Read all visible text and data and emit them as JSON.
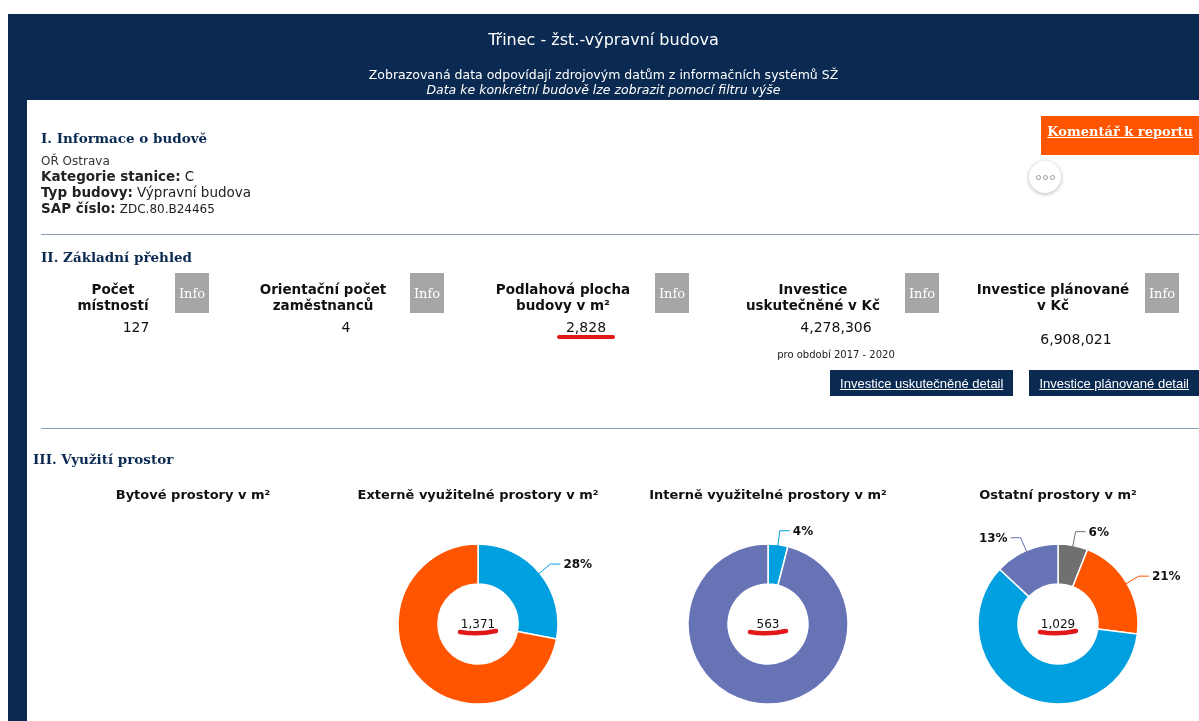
{
  "header": {
    "title": "Třinec - žst.-výpravní budova",
    "subtitle": "Zobrazovaná data odpovídají zdrojovým datům z informačních systémů SŽ",
    "note": "Data ke konkrétní budově lze zobrazit pomocí filtru výše"
  },
  "comment_button": "Komentář k reportu",
  "section_1": {
    "heading": "I. Informace o budově",
    "region": "OŘ Ostrava",
    "fields": [
      {
        "label": "Kategorie stanice:",
        "value": "C"
      },
      {
        "label": "Typ budovy:",
        "value": "Výpravní budova"
      },
      {
        "label": "SAP číslo:",
        "value": "ZDC.80.B24465"
      }
    ]
  },
  "section_2": {
    "heading": "II. Základní přehled",
    "metrics": [
      {
        "label": "Počet místností",
        "value": "127",
        "info": "Info"
      },
      {
        "label": "Orientační počet zaměstnanců",
        "value": "4",
        "info": "Info"
      },
      {
        "label": "Podlahová plocha budovy v m²",
        "value": "2,828",
        "info": "Info",
        "underlined": true
      },
      {
        "label": "Investice uskutečněné v Kč",
        "value": "4,278,306",
        "info": "Info",
        "note": "pro období 2017 - 2020"
      },
      {
        "label": "Investice plánované v Kč",
        "value": "6,908,021",
        "info": "Info"
      }
    ],
    "buttons": [
      "Investice uskutečněné detail",
      "Investice plánované detail"
    ]
  },
  "section_3": {
    "heading": "III. Využití prostor",
    "charts": [
      {
        "title": "Bytové prostory v m²"
      },
      {
        "title": "Externě využitelné prostory v m²",
        "total": "1,371",
        "underlined": true,
        "chart_data": {
          "type": "donut",
          "values": [
            28,
            72
          ],
          "colors": [
            "#009fdf",
            "#ff5500"
          ],
          "value_labels": [
            "28%",
            null
          ]
        }
      },
      {
        "title": "Interně využitelné prostory v m²",
        "total": "563",
        "underlined": true,
        "chart_data": {
          "type": "donut",
          "values": [
            4,
            96
          ],
          "colors": [
            "#009fdf",
            "#6673b5"
          ],
          "value_labels": [
            "4%",
            null
          ]
        }
      },
      {
        "title": "Ostatní prostory v m²",
        "total": "1,029",
        "underlined": true,
        "chart_data": {
          "type": "donut",
          "values": [
            6,
            21,
            60,
            13
          ],
          "colors": [
            "#707070",
            "#ff5500",
            "#009fdf",
            "#6673b5"
          ],
          "value_labels": [
            "6%",
            "21%",
            null,
            "13%"
          ]
        }
      }
    ]
  }
}
